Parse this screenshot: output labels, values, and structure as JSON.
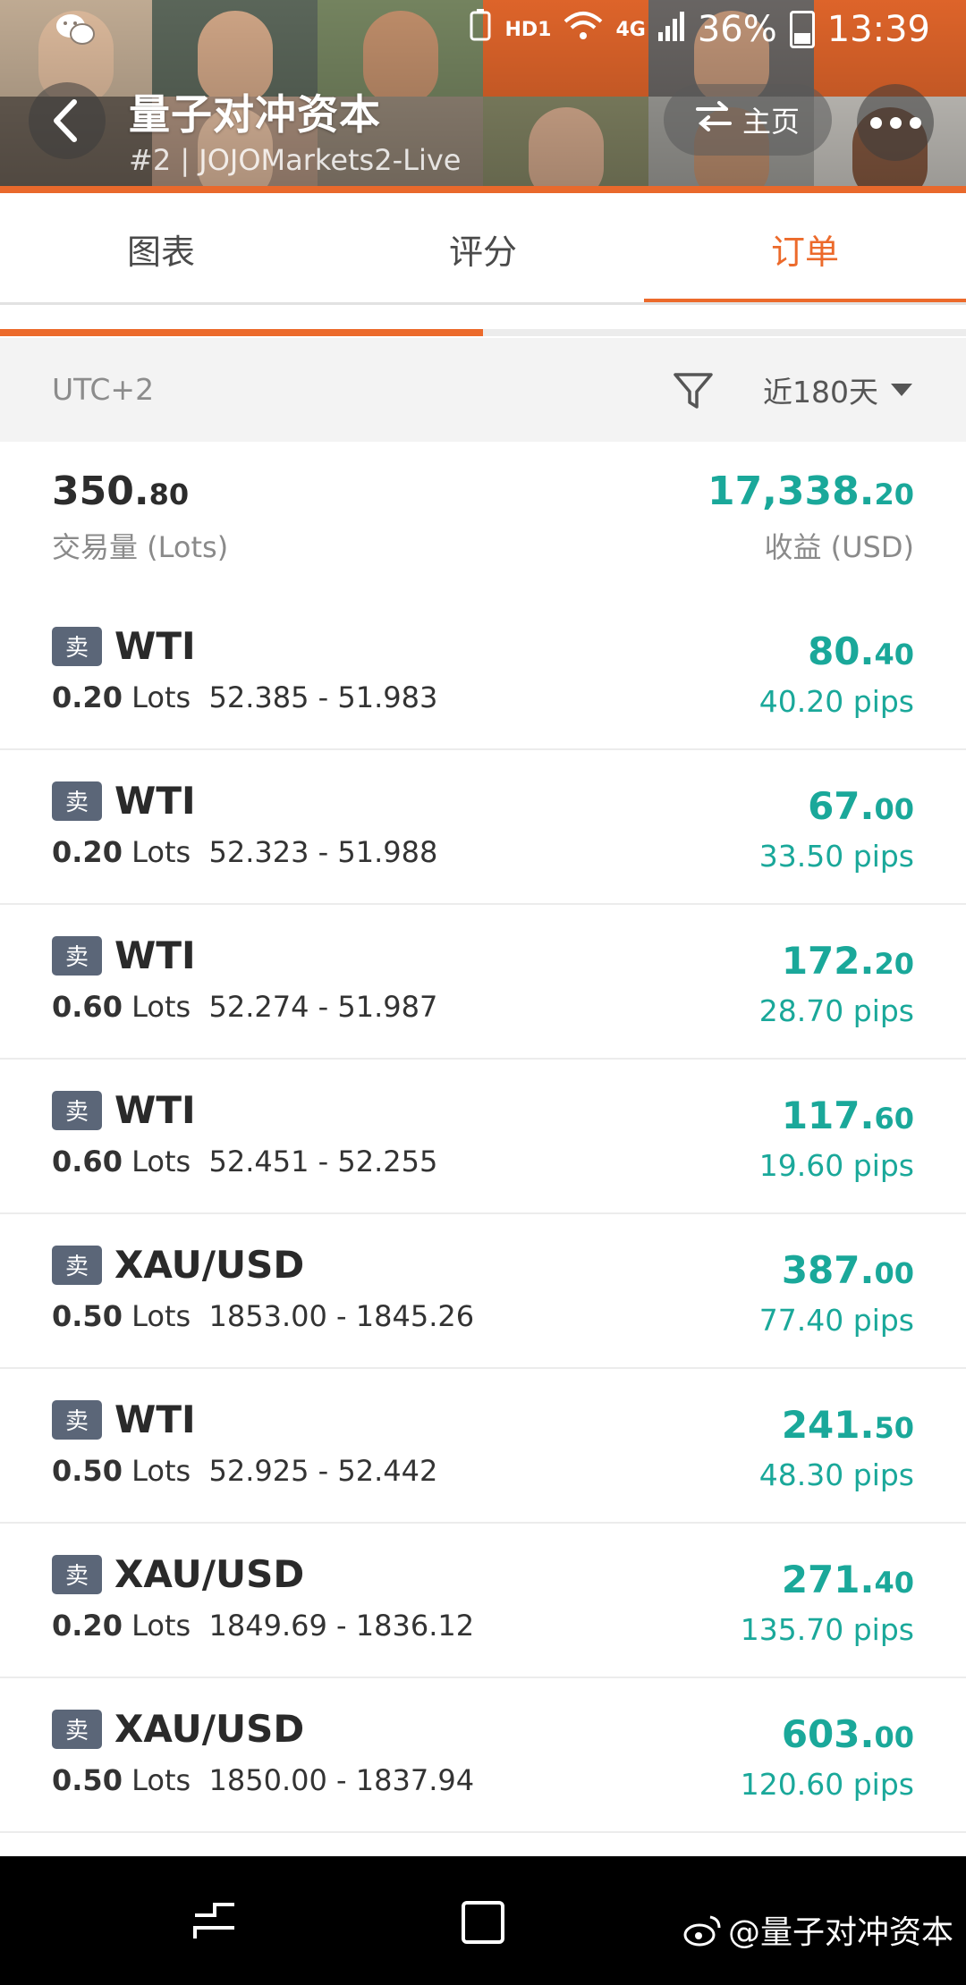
{
  "status_bar": {
    "network_label": "HD1",
    "signal_label": "4G",
    "battery": "36%",
    "time": "13:39"
  },
  "header": {
    "title": "量子对冲资本",
    "subtitle": "#2 | JOJOMarkets2-Live",
    "home_label": "主页"
  },
  "tabs": [
    {
      "label": "图表",
      "active": false
    },
    {
      "label": "评分",
      "active": false
    },
    {
      "label": "订单",
      "active": true
    }
  ],
  "sub_progress_fraction": 0.5,
  "filter": {
    "timezone": "UTC+2",
    "range": "近180天"
  },
  "summary": {
    "volume_int": "350.",
    "volume_dec": "80",
    "volume_label": "交易量 (Lots)",
    "profit_int": "17,338.",
    "profit_dec": "20",
    "profit_label": "收益 (USD)"
  },
  "orders": [
    {
      "side": "卖",
      "symbol": "WTI",
      "lots": "0.20",
      "lots_unit": "Lots",
      "prices": "52.385 - 51.983",
      "profit_int": "80.",
      "profit_dec": "40",
      "pips": "40.20 pips"
    },
    {
      "side": "卖",
      "symbol": "WTI",
      "lots": "0.20",
      "lots_unit": "Lots",
      "prices": "52.323 - 51.988",
      "profit_int": "67.",
      "profit_dec": "00",
      "pips": "33.50 pips"
    },
    {
      "side": "卖",
      "symbol": "WTI",
      "lots": "0.60",
      "lots_unit": "Lots",
      "prices": "52.274 - 51.987",
      "profit_int": "172.",
      "profit_dec": "20",
      "pips": "28.70 pips"
    },
    {
      "side": "卖",
      "symbol": "WTI",
      "lots": "0.60",
      "lots_unit": "Lots",
      "prices": "52.451 - 52.255",
      "profit_int": "117.",
      "profit_dec": "60",
      "pips": "19.60 pips"
    },
    {
      "side": "卖",
      "symbol": "XAU/USD",
      "lots": "0.50",
      "lots_unit": "Lots",
      "prices": "1853.00 - 1845.26",
      "profit_int": "387.",
      "profit_dec": "00",
      "pips": "77.40 pips"
    },
    {
      "side": "卖",
      "symbol": "WTI",
      "lots": "0.50",
      "lots_unit": "Lots",
      "prices": "52.925 - 52.442",
      "profit_int": "241.",
      "profit_dec": "50",
      "pips": "48.30 pips"
    },
    {
      "side": "卖",
      "symbol": "XAU/USD",
      "lots": "0.20",
      "lots_unit": "Lots",
      "prices": "1849.69 - 1836.12",
      "profit_int": "271.",
      "profit_dec": "40",
      "pips": "135.70 pips"
    },
    {
      "side": "卖",
      "symbol": "XAU/USD",
      "lots": "0.50",
      "lots_unit": "Lots",
      "prices": "1850.00 - 1837.94",
      "profit_int": "603.",
      "profit_dec": "00",
      "pips": "120.60 pips"
    }
  ],
  "watermark": "@量子对冲资本",
  "colors": {
    "accent": "#ec6a2b",
    "profit_green": "#1aa89a",
    "sell_badge": "#5b6678"
  }
}
